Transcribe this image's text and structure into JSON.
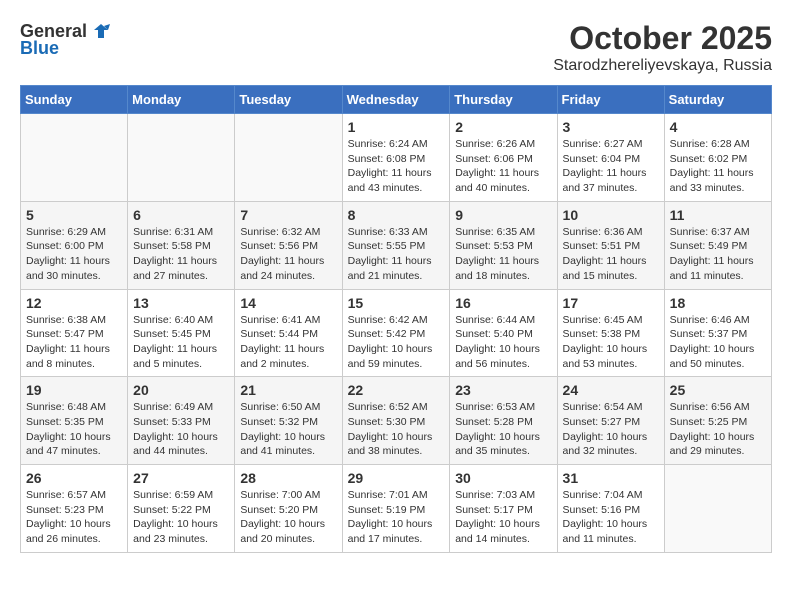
{
  "logo": {
    "general": "General",
    "blue": "Blue"
  },
  "title": {
    "month": "October 2025",
    "location": "Starodzhereliyevskaya, Russia"
  },
  "headers": [
    "Sunday",
    "Monday",
    "Tuesday",
    "Wednesday",
    "Thursday",
    "Friday",
    "Saturday"
  ],
  "weeks": [
    [
      {
        "day": "",
        "sunrise": "",
        "sunset": "",
        "daylight": ""
      },
      {
        "day": "",
        "sunrise": "",
        "sunset": "",
        "daylight": ""
      },
      {
        "day": "",
        "sunrise": "",
        "sunset": "",
        "daylight": ""
      },
      {
        "day": "1",
        "sunrise": "Sunrise: 6:24 AM",
        "sunset": "Sunset: 6:08 PM",
        "daylight": "Daylight: 11 hours and 43 minutes."
      },
      {
        "day": "2",
        "sunrise": "Sunrise: 6:26 AM",
        "sunset": "Sunset: 6:06 PM",
        "daylight": "Daylight: 11 hours and 40 minutes."
      },
      {
        "day": "3",
        "sunrise": "Sunrise: 6:27 AM",
        "sunset": "Sunset: 6:04 PM",
        "daylight": "Daylight: 11 hours and 37 minutes."
      },
      {
        "day": "4",
        "sunrise": "Sunrise: 6:28 AM",
        "sunset": "Sunset: 6:02 PM",
        "daylight": "Daylight: 11 hours and 33 minutes."
      }
    ],
    [
      {
        "day": "5",
        "sunrise": "Sunrise: 6:29 AM",
        "sunset": "Sunset: 6:00 PM",
        "daylight": "Daylight: 11 hours and 30 minutes."
      },
      {
        "day": "6",
        "sunrise": "Sunrise: 6:31 AM",
        "sunset": "Sunset: 5:58 PM",
        "daylight": "Daylight: 11 hours and 27 minutes."
      },
      {
        "day": "7",
        "sunrise": "Sunrise: 6:32 AM",
        "sunset": "Sunset: 5:56 PM",
        "daylight": "Daylight: 11 hours and 24 minutes."
      },
      {
        "day": "8",
        "sunrise": "Sunrise: 6:33 AM",
        "sunset": "Sunset: 5:55 PM",
        "daylight": "Daylight: 11 hours and 21 minutes."
      },
      {
        "day": "9",
        "sunrise": "Sunrise: 6:35 AM",
        "sunset": "Sunset: 5:53 PM",
        "daylight": "Daylight: 11 hours and 18 minutes."
      },
      {
        "day": "10",
        "sunrise": "Sunrise: 6:36 AM",
        "sunset": "Sunset: 5:51 PM",
        "daylight": "Daylight: 11 hours and 15 minutes."
      },
      {
        "day": "11",
        "sunrise": "Sunrise: 6:37 AM",
        "sunset": "Sunset: 5:49 PM",
        "daylight": "Daylight: 11 hours and 11 minutes."
      }
    ],
    [
      {
        "day": "12",
        "sunrise": "Sunrise: 6:38 AM",
        "sunset": "Sunset: 5:47 PM",
        "daylight": "Daylight: 11 hours and 8 minutes."
      },
      {
        "day": "13",
        "sunrise": "Sunrise: 6:40 AM",
        "sunset": "Sunset: 5:45 PM",
        "daylight": "Daylight: 11 hours and 5 minutes."
      },
      {
        "day": "14",
        "sunrise": "Sunrise: 6:41 AM",
        "sunset": "Sunset: 5:44 PM",
        "daylight": "Daylight: 11 hours and 2 minutes."
      },
      {
        "day": "15",
        "sunrise": "Sunrise: 6:42 AM",
        "sunset": "Sunset: 5:42 PM",
        "daylight": "Daylight: 10 hours and 59 minutes."
      },
      {
        "day": "16",
        "sunrise": "Sunrise: 6:44 AM",
        "sunset": "Sunset: 5:40 PM",
        "daylight": "Daylight: 10 hours and 56 minutes."
      },
      {
        "day": "17",
        "sunrise": "Sunrise: 6:45 AM",
        "sunset": "Sunset: 5:38 PM",
        "daylight": "Daylight: 10 hours and 53 minutes."
      },
      {
        "day": "18",
        "sunrise": "Sunrise: 6:46 AM",
        "sunset": "Sunset: 5:37 PM",
        "daylight": "Daylight: 10 hours and 50 minutes."
      }
    ],
    [
      {
        "day": "19",
        "sunrise": "Sunrise: 6:48 AM",
        "sunset": "Sunset: 5:35 PM",
        "daylight": "Daylight: 10 hours and 47 minutes."
      },
      {
        "day": "20",
        "sunrise": "Sunrise: 6:49 AM",
        "sunset": "Sunset: 5:33 PM",
        "daylight": "Daylight: 10 hours and 44 minutes."
      },
      {
        "day": "21",
        "sunrise": "Sunrise: 6:50 AM",
        "sunset": "Sunset: 5:32 PM",
        "daylight": "Daylight: 10 hours and 41 minutes."
      },
      {
        "day": "22",
        "sunrise": "Sunrise: 6:52 AM",
        "sunset": "Sunset: 5:30 PM",
        "daylight": "Daylight: 10 hours and 38 minutes."
      },
      {
        "day": "23",
        "sunrise": "Sunrise: 6:53 AM",
        "sunset": "Sunset: 5:28 PM",
        "daylight": "Daylight: 10 hours and 35 minutes."
      },
      {
        "day": "24",
        "sunrise": "Sunrise: 6:54 AM",
        "sunset": "Sunset: 5:27 PM",
        "daylight": "Daylight: 10 hours and 32 minutes."
      },
      {
        "day": "25",
        "sunrise": "Sunrise: 6:56 AM",
        "sunset": "Sunset: 5:25 PM",
        "daylight": "Daylight: 10 hours and 29 minutes."
      }
    ],
    [
      {
        "day": "26",
        "sunrise": "Sunrise: 6:57 AM",
        "sunset": "Sunset: 5:23 PM",
        "daylight": "Daylight: 10 hours and 26 minutes."
      },
      {
        "day": "27",
        "sunrise": "Sunrise: 6:59 AM",
        "sunset": "Sunset: 5:22 PM",
        "daylight": "Daylight: 10 hours and 23 minutes."
      },
      {
        "day": "28",
        "sunrise": "Sunrise: 7:00 AM",
        "sunset": "Sunset: 5:20 PM",
        "daylight": "Daylight: 10 hours and 20 minutes."
      },
      {
        "day": "29",
        "sunrise": "Sunrise: 7:01 AM",
        "sunset": "Sunset: 5:19 PM",
        "daylight": "Daylight: 10 hours and 17 minutes."
      },
      {
        "day": "30",
        "sunrise": "Sunrise: 7:03 AM",
        "sunset": "Sunset: 5:17 PM",
        "daylight": "Daylight: 10 hours and 14 minutes."
      },
      {
        "day": "31",
        "sunrise": "Sunrise: 7:04 AM",
        "sunset": "Sunset: 5:16 PM",
        "daylight": "Daylight: 10 hours and 11 minutes."
      },
      {
        "day": "",
        "sunrise": "",
        "sunset": "",
        "daylight": ""
      }
    ]
  ]
}
